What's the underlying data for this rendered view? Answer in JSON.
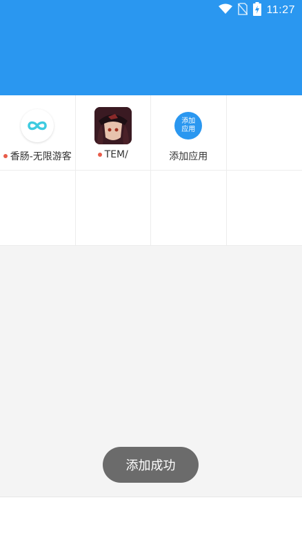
{
  "status_bar": {
    "time": "11:27"
  },
  "apps": [
    {
      "label": "香肠-无限游客",
      "icon": "infinity-icon",
      "new_badge": true
    },
    {
      "label": "TEM/",
      "icon": "game-avatar-icon",
      "new_badge": true
    },
    {
      "label": "添加应用",
      "icon": "add-app-icon",
      "icon_text_line1": "添加",
      "icon_text_line2": "应用",
      "new_badge": false
    }
  ],
  "toast": {
    "text": "添加成功"
  },
  "colors": {
    "primary": "#2a97f0",
    "badge": "#e85c4a",
    "infinity": "#3ecbe0"
  }
}
